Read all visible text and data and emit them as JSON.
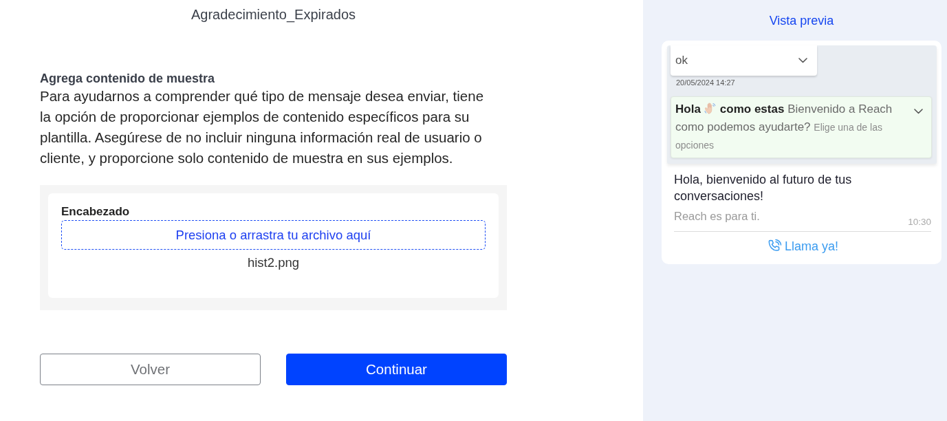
{
  "header": {
    "title": "Agradecimiento_Expirados"
  },
  "sample_content": {
    "heading": "Agrega contenido de muestra",
    "description": "Para ayudarnos a comprender qué tipo de mensaje desea enviar, tiene la opción de proporcionar ejemplos de contenido específicos para su plantilla. Asegúrese de no incluir ninguna información real de usuario o cliente, y proporcione solo contenido de muestra en sus ejemplos.",
    "header_field": {
      "label": "Encabezado",
      "dropzone": "Presiona o arrastra tu archivo aquí",
      "file_name": "hist2.png"
    }
  },
  "buttons": [
    {
      "label": "Volver",
      "kind": "secondary"
    },
    {
      "label": "Continuar",
      "kind": "primary"
    }
  ],
  "preview": {
    "title": "Vista previa",
    "reply_bubble": {
      "text": "ok"
    },
    "timestamp": "20/05/2024 14:27",
    "quoted_message": {
      "title_start": "Hola",
      "title_end": "como estas",
      "body": "Bienvenido a Reach como podemos ayudarte?",
      "footer": "Elige una de las opciones"
    },
    "message": {
      "body": "Hola, bienvenido al futuro de tus conversaciones!",
      "footer": "Reach es para ti.",
      "time": "10:30"
    },
    "actions": [
      {
        "kind": "call",
        "label": "Llama ya!"
      }
    ]
  }
}
